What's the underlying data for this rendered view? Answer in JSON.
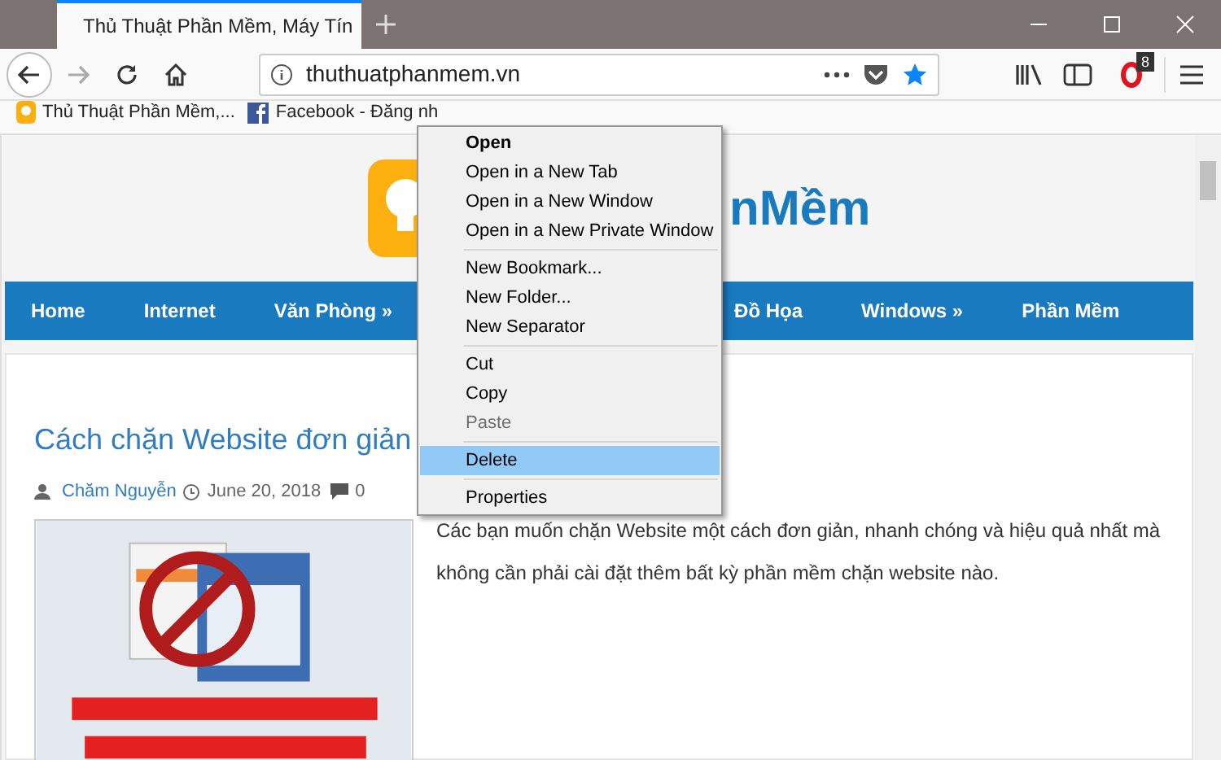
{
  "tabs": [
    {
      "title": "Thủ Thuật Phần Mềm, Máy Tín",
      "selected": true
    }
  ],
  "address_bar": {
    "url": "thuthuatphanmem.vn",
    "bookmarked": true
  },
  "extension_badge": "8",
  "bookmarks": [
    {
      "label": "Thủ Thuật Phần Mềm,...",
      "kind": "bulb"
    },
    {
      "label": "Facebook - Đăng nh",
      "kind": "facebook"
    }
  ],
  "site": {
    "logo_text": "nMềm",
    "nav": [
      {
        "label": "Home"
      },
      {
        "label": "Internet"
      },
      {
        "label": "Văn Phòng »"
      },
      {
        "label": "Đồ Họa"
      },
      {
        "label": "Windows »"
      },
      {
        "label": "Phần Mềm"
      }
    ],
    "article": {
      "title": "Cách chặn Website đơn giản",
      "author": "Chăm Nguyễn",
      "date": "June 20, 2018",
      "comments": "0",
      "excerpt": "Các bạn muốn chặn Website một cách đơn giản, nhanh chóng và hiệu quả nhất mà không cần phải cài đặt thêm bất kỳ phần mềm chặn website nào."
    }
  },
  "context_menu": [
    {
      "kind": "item",
      "label": "Open",
      "bold": true,
      "disabled": false,
      "selected": false
    },
    {
      "kind": "item",
      "label": "Open in a New Tab",
      "bold": false,
      "disabled": false,
      "selected": false
    },
    {
      "kind": "item",
      "label": "Open in a New Window",
      "bold": false,
      "disabled": false,
      "selected": false
    },
    {
      "kind": "item",
      "label": "Open in a New Private Window",
      "bold": false,
      "disabled": false,
      "selected": false
    },
    {
      "kind": "separator"
    },
    {
      "kind": "item",
      "label": "New Bookmark...",
      "bold": false,
      "disabled": false,
      "selected": false
    },
    {
      "kind": "item",
      "label": "New Folder...",
      "bold": false,
      "disabled": false,
      "selected": false
    },
    {
      "kind": "item",
      "label": "New Separator",
      "bold": false,
      "disabled": false,
      "selected": false
    },
    {
      "kind": "separator"
    },
    {
      "kind": "item",
      "label": "Cut",
      "bold": false,
      "disabled": false,
      "selected": false
    },
    {
      "kind": "item",
      "label": "Copy",
      "bold": false,
      "disabled": false,
      "selected": false
    },
    {
      "kind": "item",
      "label": "Paste",
      "bold": false,
      "disabled": true,
      "selected": false
    },
    {
      "kind": "separator"
    },
    {
      "kind": "item",
      "label": "Delete",
      "bold": false,
      "disabled": false,
      "selected": true
    },
    {
      "kind": "separator"
    },
    {
      "kind": "item",
      "label": "Properties",
      "bold": false,
      "disabled": false,
      "selected": false
    }
  ]
}
